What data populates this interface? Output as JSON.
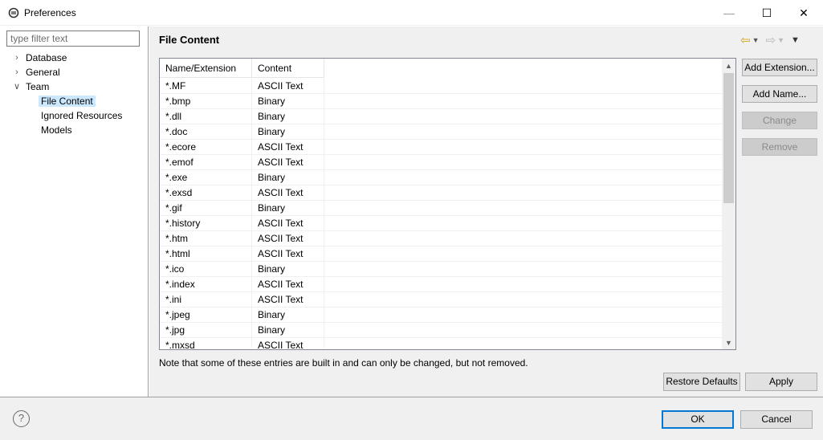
{
  "window": {
    "title": "Preferences",
    "minimize_icon": "minimize-icon",
    "maximize_icon": "maximize-icon",
    "close_icon": "close-icon"
  },
  "sidebar": {
    "filter_placeholder": "type filter text",
    "items": [
      {
        "label": "Database",
        "expanded": false
      },
      {
        "label": "General",
        "expanded": false
      },
      {
        "label": "Team",
        "expanded": true
      },
      {
        "label": "File Content",
        "selected": true
      },
      {
        "label": "Ignored Resources"
      },
      {
        "label": "Models"
      }
    ]
  },
  "page": {
    "title": "File Content",
    "columns": [
      "Name/Extension",
      "Content"
    ],
    "rows": [
      [
        "*.MF",
        "ASCII Text"
      ],
      [
        "*.bmp",
        "Binary"
      ],
      [
        "*.dll",
        "Binary"
      ],
      [
        "*.doc",
        "Binary"
      ],
      [
        "*.ecore",
        "ASCII Text"
      ],
      [
        "*.emof",
        "ASCII Text"
      ],
      [
        "*.exe",
        "Binary"
      ],
      [
        "*.exsd",
        "ASCII Text"
      ],
      [
        "*.gif",
        "Binary"
      ],
      [
        "*.history",
        "ASCII Text"
      ],
      [
        "*.htm",
        "ASCII Text"
      ],
      [
        "*.html",
        "ASCII Text"
      ],
      [
        "*.ico",
        "Binary"
      ],
      [
        "*.index",
        "ASCII Text"
      ],
      [
        "*.ini",
        "ASCII Text"
      ],
      [
        "*.jpeg",
        "Binary"
      ],
      [
        "*.jpg",
        "Binary"
      ],
      [
        "*.mxsd",
        "ASCII Text"
      ]
    ],
    "buttons": {
      "add_extension": "Add Extension...",
      "add_name": "Add Name...",
      "change": "Change",
      "remove": "Remove"
    },
    "note": "Note that some of these entries are built in and can only be changed, but not removed.",
    "restore_defaults": "Restore Defaults",
    "apply": "Apply"
  },
  "footer": {
    "help_symbol": "?",
    "ok": "OK",
    "cancel": "Cancel"
  },
  "colors": {
    "selection": "#cce8ff",
    "accent": "#0078d7",
    "back_arrow": "#d8a200"
  }
}
